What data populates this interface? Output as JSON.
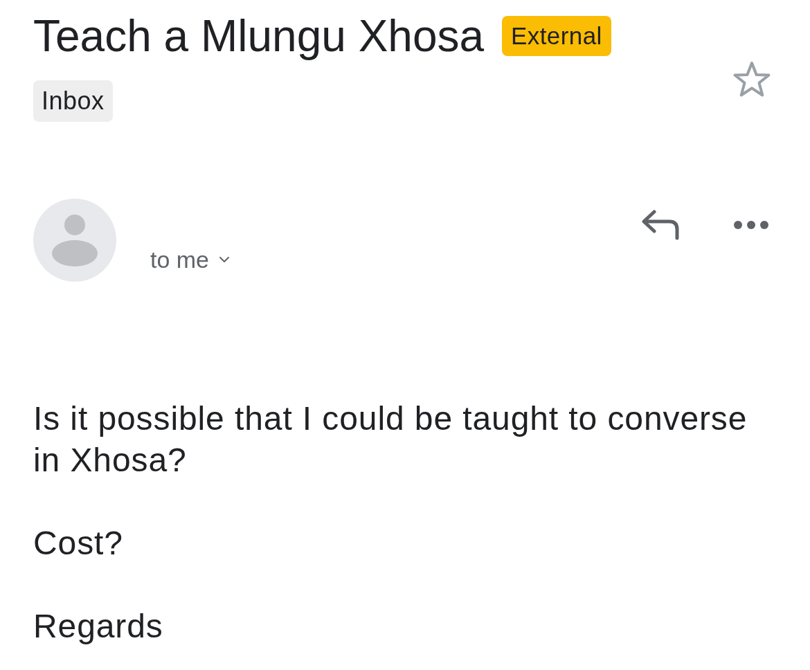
{
  "email": {
    "subject": "Teach a Mlungu Xhosa",
    "tags": [
      {
        "label": "External"
      }
    ],
    "labels": [
      {
        "label": "Inbox"
      }
    ],
    "starred": false
  },
  "sender": {
    "recipient_line": "to me"
  },
  "body": {
    "paragraphs": [
      "Is it possible that I could be taught to converse in Xhosa?",
      "Cost?",
      "Regards"
    ]
  }
}
